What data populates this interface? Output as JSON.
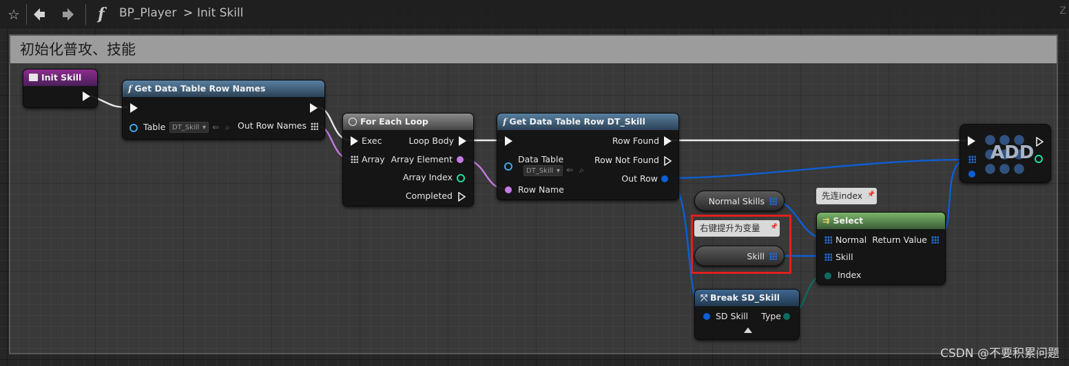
{
  "breadcrumb": {
    "blueprint": "BP_Player",
    "function": "Init Skill",
    "separator": ">",
    "zoom": "Z"
  },
  "comment_title": "初始化普攻、技能",
  "nodes": {
    "init_skill": {
      "title": "Init Skill"
    },
    "get_row_names": {
      "title": "Get Data Table Row Names",
      "table_label": "Table",
      "table_value": "DT_Skill",
      "out_label": "Out Row Names"
    },
    "for_each": {
      "title": "For Each Loop",
      "exec": "Exec",
      "array": "Array",
      "loop_body": "Loop Body",
      "array_element": "Array Element",
      "array_index": "Array Index",
      "completed": "Completed"
    },
    "get_row": {
      "title": "Get Data Table Row DT_Skill",
      "data_table": "Data Table",
      "data_table_value": "DT_Skill",
      "row_name": "Row Name",
      "row_found": "Row Found",
      "row_not_found": "Row Not Found",
      "out_row": "Out Row"
    },
    "add": {
      "title": "ADD"
    },
    "normal_skills": {
      "label": "Normal Skills"
    },
    "skill_var": {
      "label": "Skill"
    },
    "select": {
      "title": "Select",
      "normal": "Normal",
      "skill": "Skill",
      "index": "Index",
      "return_value": "Return Value"
    },
    "break": {
      "title": "Break SD_Skill",
      "sd_skill": "SD Skill",
      "type": "Type"
    }
  },
  "tooltips": {
    "promote": "右键提升为变量",
    "first_index": "先连index"
  },
  "watermark": "CSDN @不要积累问题",
  "colors": {
    "exec": "#f3f3f3",
    "struct": "#0c5fd6",
    "name": "#c57be3",
    "int": "#1fe0a6",
    "enum": "#0e6b5f",
    "highlight": "#e0201c"
  }
}
